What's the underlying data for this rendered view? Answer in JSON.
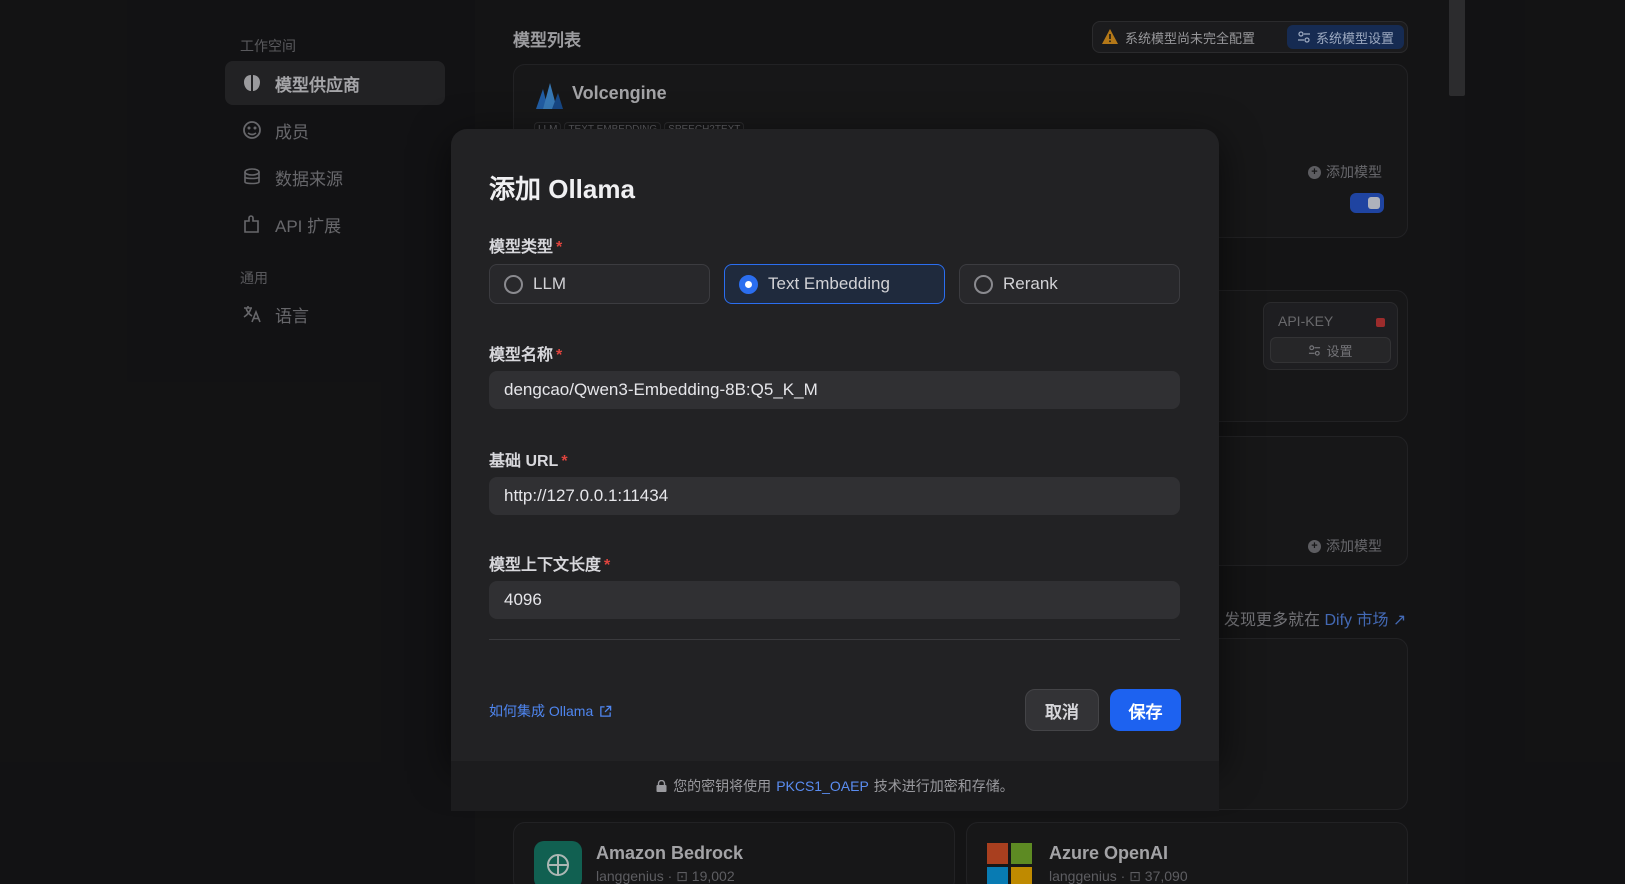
{
  "sidebar": {
    "section_workspace": "工作空间",
    "items": [
      {
        "label": "模型供应商",
        "icon": "brain-icon",
        "active": true
      },
      {
        "label": "成员",
        "icon": "members-icon"
      },
      {
        "label": "数据来源",
        "icon": "database-icon"
      },
      {
        "label": "API 扩展",
        "icon": "puzzle-icon"
      }
    ],
    "section_general": "通用",
    "general_items": [
      {
        "label": "语言",
        "icon": "translate-icon"
      }
    ]
  },
  "main": {
    "list_title": "模型列表",
    "warning_text": "系统模型尚未完全配置",
    "system_model_settings": "系统模型设置",
    "provider_volcengine": {
      "name": "Volcengine",
      "tags": [
        "LLM",
        "TEXT EMBEDDING",
        "SPEECH2TEXT"
      ],
      "add_model": "添加模型"
    },
    "apikey": {
      "label": "API-KEY",
      "settings": "设置"
    },
    "add_model_2": "添加模型",
    "discover_prefix": "发现更多就在",
    "discover_link": "Dify 市场",
    "marketplace": [
      {
        "name": "Amazon Bedrock",
        "author": "langgenius",
        "installs": "19,002"
      },
      {
        "name": "Azure OpenAI",
        "author": "langgenius",
        "installs": "37,090"
      }
    ]
  },
  "modal": {
    "title": "添加 Ollama",
    "model_type_label": "模型类型",
    "model_types": [
      "LLM",
      "Text Embedding",
      "Rerank"
    ],
    "selected_model_type": "Text Embedding",
    "model_name_label": "模型名称",
    "model_name_value": "dengcao/Qwen3-Embedding-8B:Q5_K_M",
    "base_url_label": "基础 URL",
    "base_url_value": "http://127.0.0.1:11434",
    "context_length_label": "模型上下文长度",
    "context_length_value": "4096",
    "required_mark": "*",
    "help_link": "如何集成 Ollama",
    "cancel": "取消",
    "save": "保存",
    "footer_prefix": "您的密钥将使用",
    "footer_link": "PKCS1_OAEP",
    "footer_suffix": "技术进行加密和存储。"
  },
  "colors": {
    "accent": "#1d62f0",
    "danger": "#e0443e",
    "link": "#4f86f0"
  }
}
